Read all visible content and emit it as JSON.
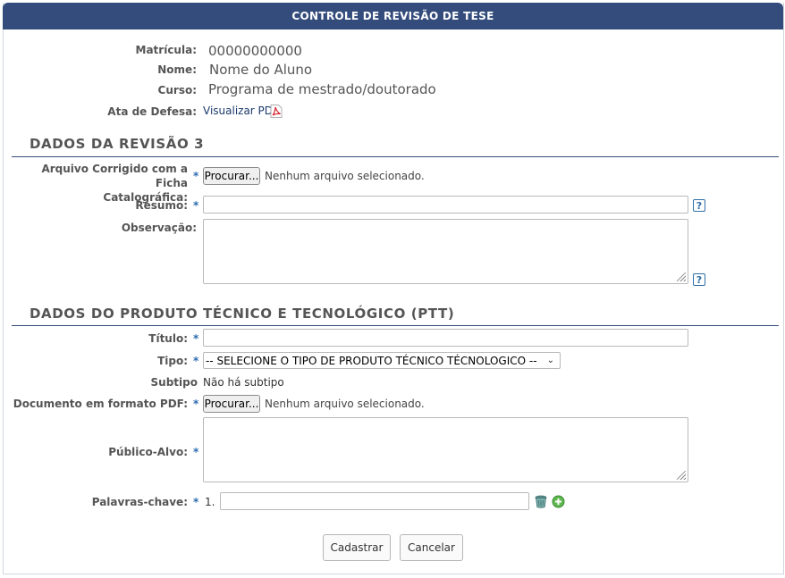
{
  "header": {
    "title": "CONTROLE DE REVISÃO DE TESE"
  },
  "student": {
    "matricula_label": "Matrícula:",
    "matricula_value": "00000000000",
    "nome_label": "Nome:",
    "nome_value": "Nome do Aluno",
    "curso_label": "Curso:",
    "curso_value": "Programa de mestrado/doutorado",
    "ata_label": "Ata de Defesa:",
    "ata_link": "Visualizar PDF"
  },
  "revisao": {
    "section_title": "DADOS DA REVISÃO 3",
    "arquivo_label_line1": "Arquivo Corrigido com a Ficha",
    "arquivo_label_line2": "Catalográfica:",
    "arquivo_button": "Procurar...",
    "arquivo_status": "Nenhum arquivo selecionado.",
    "resumo_label": "Resumo:",
    "resumo_value": "",
    "observacao_label": "Observação:",
    "observacao_value": "",
    "help_glyph": "?"
  },
  "ptt": {
    "section_title": "DADOS DO PRODUTO TÉCNICO E TECNOLÓGICO (PTT)",
    "titulo_label": "Título:",
    "titulo_value": "",
    "tipo_label": "Tipo:",
    "tipo_selected": "-- SELECIONE O TIPO DE PRODUTO TÉCNICO TÉCNOLOGICO --",
    "subtipo_label": "Subtipo",
    "subtipo_value": "Não há subtipo",
    "documento_label": "Documento em formato PDF:",
    "documento_button": "Procurar...",
    "documento_status": "Nenhum arquivo selecionado.",
    "publico_label": "Público-Alvo:",
    "publico_value": "",
    "palavras_label": "Palavras-chave:",
    "palavras_index": "1.",
    "palavras_value": ""
  },
  "required_mark": "*",
  "actions": {
    "submit": "Cadastrar",
    "cancel": "Cancelar"
  },
  "colors": {
    "header_bg": "#344c7c",
    "required": "#2b6cb0",
    "help": "#2f6fa8"
  }
}
